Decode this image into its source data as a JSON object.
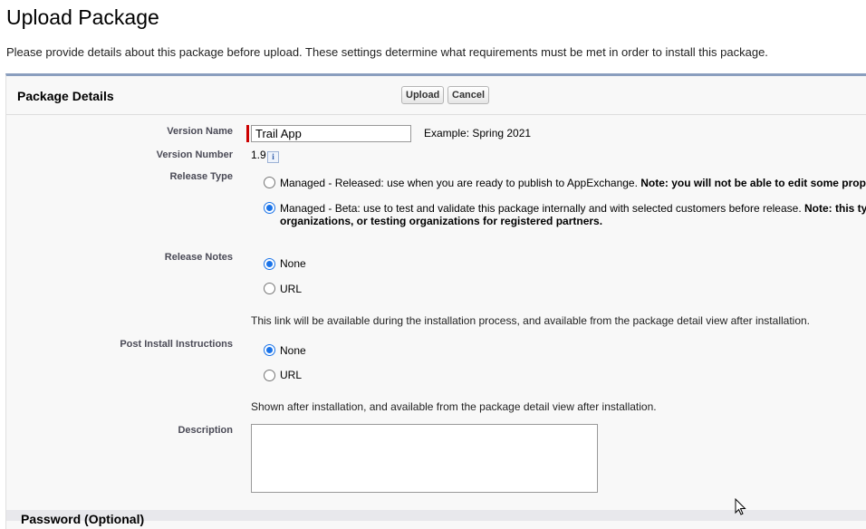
{
  "page": {
    "title": "Upload Package",
    "subtitle": "Please provide details about this package before upload. These settings determine what requirements must be met in order to install this package."
  },
  "panel": {
    "title": "Package Details",
    "upload_label": "Upload",
    "cancel_label": "Cancel"
  },
  "fields": {
    "version_name": {
      "label": "Version Name",
      "value": "Trail App",
      "example": "Example: Spring 2021"
    },
    "version_number": {
      "label": "Version Number",
      "value": "1.9",
      "info_icon": "i"
    },
    "release_type": {
      "label": "Release Type",
      "options": [
        {
          "text": "Managed - Released: use when you are ready to publish to AppExchange. ",
          "bold": "Note: you will not be able to edit some prop",
          "selected": false
        },
        {
          "text": "Managed - Beta: use to test and validate this package internally and with selected customers before release. ",
          "bold": "Note: this ty",
          "bold_line2": "organizations, or testing organizations for registered partners.",
          "selected": true
        }
      ]
    },
    "release_notes": {
      "label": "Release Notes",
      "options": [
        {
          "text": "None",
          "selected": true
        },
        {
          "text": "URL",
          "selected": false
        }
      ],
      "help": "This link will be available during the installation process, and available from the package detail view after installation."
    },
    "post_install": {
      "label": "Post Install Instructions",
      "options": [
        {
          "text": "None",
          "selected": true
        },
        {
          "text": "URL",
          "selected": false
        }
      ],
      "help": "Shown after installation, and available from the package detail view after installation."
    },
    "description": {
      "label": "Description",
      "value": ""
    }
  },
  "next_section": {
    "title": "Password (Optional)"
  },
  "colors": {
    "panel_border": "#8a9ebe",
    "required": "#cc0000",
    "radio_accent": "#1a73e8"
  }
}
